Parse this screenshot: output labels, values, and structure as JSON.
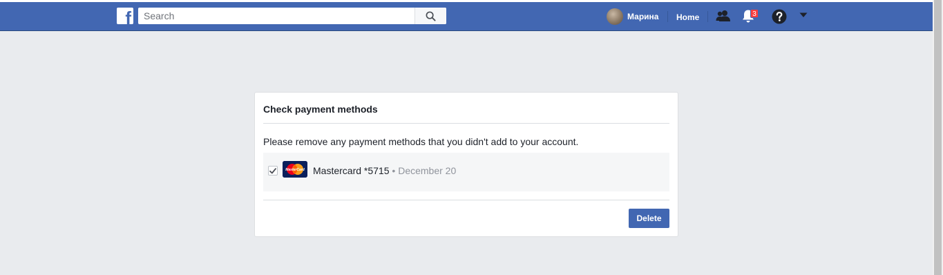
{
  "colors": {
    "brand_blue": "#4267b2",
    "page_background": "#e9ebee",
    "notification_red": "#fa3e3e"
  },
  "header": {
    "logo_icon": "facebook-logo-icon",
    "logo_glyph": "f",
    "search": {
      "placeholder": "Search",
      "value": ""
    },
    "search_icon": "search-icon",
    "profile_name": "Марина",
    "home_label": "Home",
    "friends_icon": "friends-icon",
    "notifications_icon": "bell-icon",
    "notifications_count": "3",
    "help_icon": "question-icon",
    "account_menu_icon": "caret-down-icon"
  },
  "card": {
    "title": "Check payment methods",
    "description": "Please remove any payment methods that you didn't add to your account.",
    "payment_methods": [
      {
        "checked": true,
        "card_icon": "mastercard-icon",
        "card_icon_text": "MasterCard",
        "label": "Mastercard *5715",
        "separator": "•",
        "date": "December 20"
      }
    ],
    "delete_label": "Delete"
  }
}
